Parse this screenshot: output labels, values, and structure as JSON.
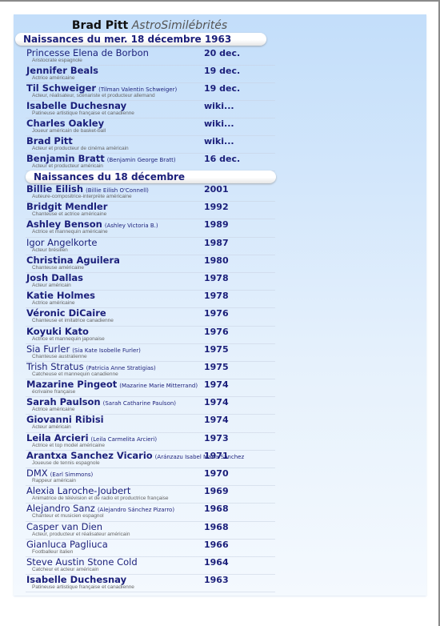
{
  "title": {
    "name": "Brad Pitt",
    "site": "AstroSimilébrités"
  },
  "section1": {
    "header": "Naissances du mer. 18 décembre 1963",
    "rows": [
      {
        "name": "Princesse Elena de Borbon",
        "alias": "",
        "desc": "Aristocrate espagnole",
        "date": "20 dec.",
        "bold": false
      },
      {
        "name": "Jennifer Beals",
        "alias": "",
        "desc": "Actrice américaine",
        "date": "19 dec.",
        "bold": true
      },
      {
        "name": "Til Schweiger",
        "alias": "(Tilman Valentin Schweiger)",
        "desc": "Acteur, réalisateur, scénariste et producteur allemand",
        "date": "19 dec.",
        "bold": true
      },
      {
        "name": "Isabelle Duchesnay",
        "alias": "",
        "desc": "Patineuse artistique française et canadienne",
        "date": "wiki...",
        "bold": true
      },
      {
        "name": "Charles Oakley",
        "alias": "",
        "desc": "Joueur américain de basket-ball",
        "date": "wiki...",
        "bold": true
      },
      {
        "name": "Brad Pitt",
        "alias": "",
        "desc": "Acteur et producteur de cinéma américain",
        "date": "wiki...",
        "bold": true
      },
      {
        "name": "Benjamin Bratt",
        "alias": "(Benjamin George Bratt)",
        "desc": "Acteur et producteur américain",
        "date": "16 dec.",
        "bold": true
      }
    ]
  },
  "section2": {
    "header": "Naissances du 18 décembre",
    "rows": [
      {
        "name": "Billie Eilish",
        "alias": "(Billie Eilish O'Connell)",
        "desc": "Auteure-compositrice-interprète américaine",
        "date": "2001",
        "bold": true
      },
      {
        "name": "Bridgit Mendler",
        "alias": "",
        "desc": "Chanteuse et actrice américaine",
        "date": "1992",
        "bold": true
      },
      {
        "name": "Ashley Benson",
        "alias": "(Ashley Victoria B.)",
        "desc": "Actrice et mannequin américaine",
        "date": "1989",
        "bold": true
      },
      {
        "name": "Igor Angelkorte",
        "alias": "",
        "desc": "Acteur brésilien",
        "date": "1987",
        "bold": false
      },
      {
        "name": "Christina Aguilera",
        "alias": "",
        "desc": "Chanteuse américaine",
        "date": "1980",
        "bold": true
      },
      {
        "name": "Josh Dallas",
        "alias": "",
        "desc": "Acteur américain",
        "date": "1978",
        "bold": true
      },
      {
        "name": "Katie Holmes",
        "alias": "",
        "desc": "Actrice américaine",
        "date": "1978",
        "bold": true
      },
      {
        "name": "Véronic DiCaire",
        "alias": "",
        "desc": "Chanteuse et imitatrice canadienne",
        "date": "1976",
        "bold": true
      },
      {
        "name": "Koyuki Kato",
        "alias": "",
        "desc": "Actrice et mannequin japonaise",
        "date": "1976",
        "bold": true
      },
      {
        "name": "Sia Furler",
        "alias": "(Sia Kate Isobelle Furler)",
        "desc": "Chanteuse australienne",
        "date": "1975",
        "bold": false
      },
      {
        "name": "Trish Stratus",
        "alias": "(Patricia Anne Stratigias)",
        "desc": "Catcheuse et mannequin canadienne",
        "date": "1975",
        "bold": false
      },
      {
        "name": "Mazarine Pingeot",
        "alias": "(Mazarine Marie Mitterrand)",
        "desc": "écrivaine française",
        "date": "1974",
        "bold": true
      },
      {
        "name": "Sarah Paulson",
        "alias": "(Sarah Catharine Paulson)",
        "desc": "Actrice américaine",
        "date": "1974",
        "bold": true
      },
      {
        "name": "Giovanni Ribisi",
        "alias": "",
        "desc": "Acteur américain",
        "date": "1974",
        "bold": true
      },
      {
        "name": "Leila Arcieri",
        "alias": "(Leila Carmelita Arcieri)",
        "desc": "Actrice et top model américaine",
        "date": "1973",
        "bold": true
      },
      {
        "name": "Arantxa Sanchez Vicario",
        "alias": "(Aránzazu Isabel María Sánchez",
        "desc": "Joueuse de tennis espagnole",
        "date": "1971",
        "bold": true
      },
      {
        "name": "DMX",
        "alias": "(Earl Simmons)",
        "desc": "Rappeur américain",
        "date": "1970",
        "bold": false
      },
      {
        "name": "Alexia Laroche-Joubert",
        "alias": "",
        "desc": "Animatrice de télévision et de radio et productrice française",
        "date": "1969",
        "bold": false
      },
      {
        "name": "Alejandro Sanz",
        "alias": "(Alejandro Sánchez Pizarro)",
        "desc": "Chanteur et musicien espagnol",
        "date": "1968",
        "bold": false
      },
      {
        "name": "Casper van Dien",
        "alias": "",
        "desc": "Acteur, producteur et réalisateur américain",
        "date": "1968",
        "bold": false
      },
      {
        "name": "Gianluca Pagliuca",
        "alias": "",
        "desc": "Footballeur italien",
        "date": "1966",
        "bold": false
      },
      {
        "name": "Steve Austin Stone Cold",
        "alias": "",
        "desc": "Catcheur et acteur américain",
        "date": "1964",
        "bold": false
      },
      {
        "name": "Isabelle Duchesnay",
        "alias": "",
        "desc": "Patineuse artistique française et canadienne",
        "date": "1963",
        "bold": true
      }
    ]
  }
}
